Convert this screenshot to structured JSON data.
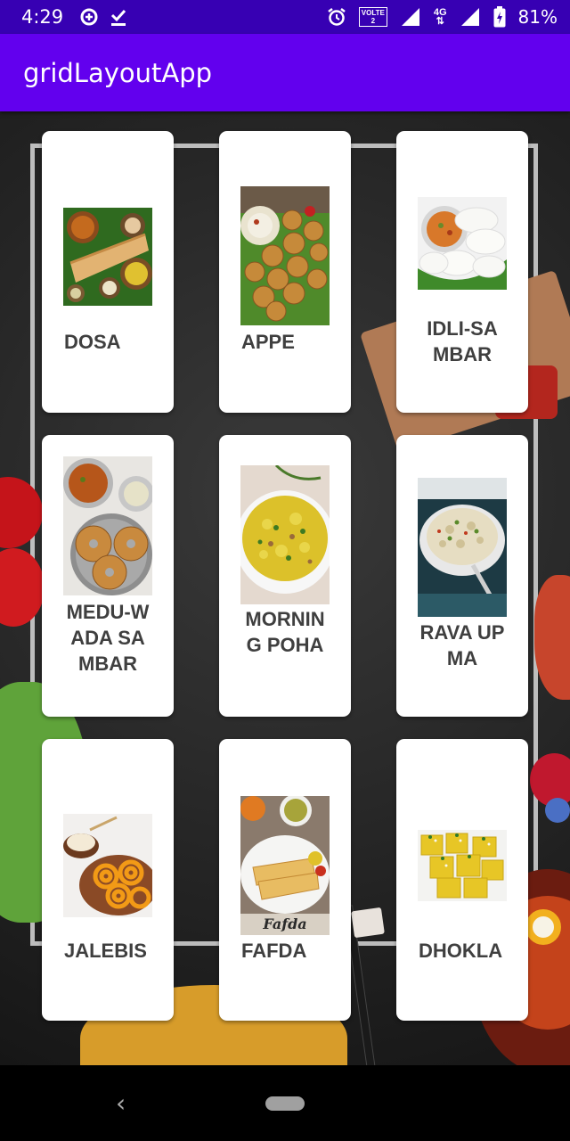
{
  "status_bar": {
    "time": "4:29",
    "battery": "81%",
    "volte_label": "VOLTE",
    "volte_sub": "2",
    "network": "4G"
  },
  "app_bar": {
    "title": "gridLayoutApp"
  },
  "items": [
    {
      "label": "DOSA"
    },
    {
      "label": "APPE"
    },
    {
      "label": "IDLI-SAMBAR"
    },
    {
      "label": "MEDU-WADA SAMBAR"
    },
    {
      "label": "MORNING POHA"
    },
    {
      "label": "RAVA UPMA"
    },
    {
      "label": "JALEBIS"
    },
    {
      "label": "FAFDA"
    },
    {
      "label": "DHOKLA"
    }
  ],
  "fafda_caption": "Fafda",
  "nav": {
    "back_glyph": "‹"
  },
  "colors": {
    "status_bar": "#3700b3",
    "app_bar": "#6200ee",
    "card": "#ffffff",
    "label": "#3f3f3f"
  }
}
